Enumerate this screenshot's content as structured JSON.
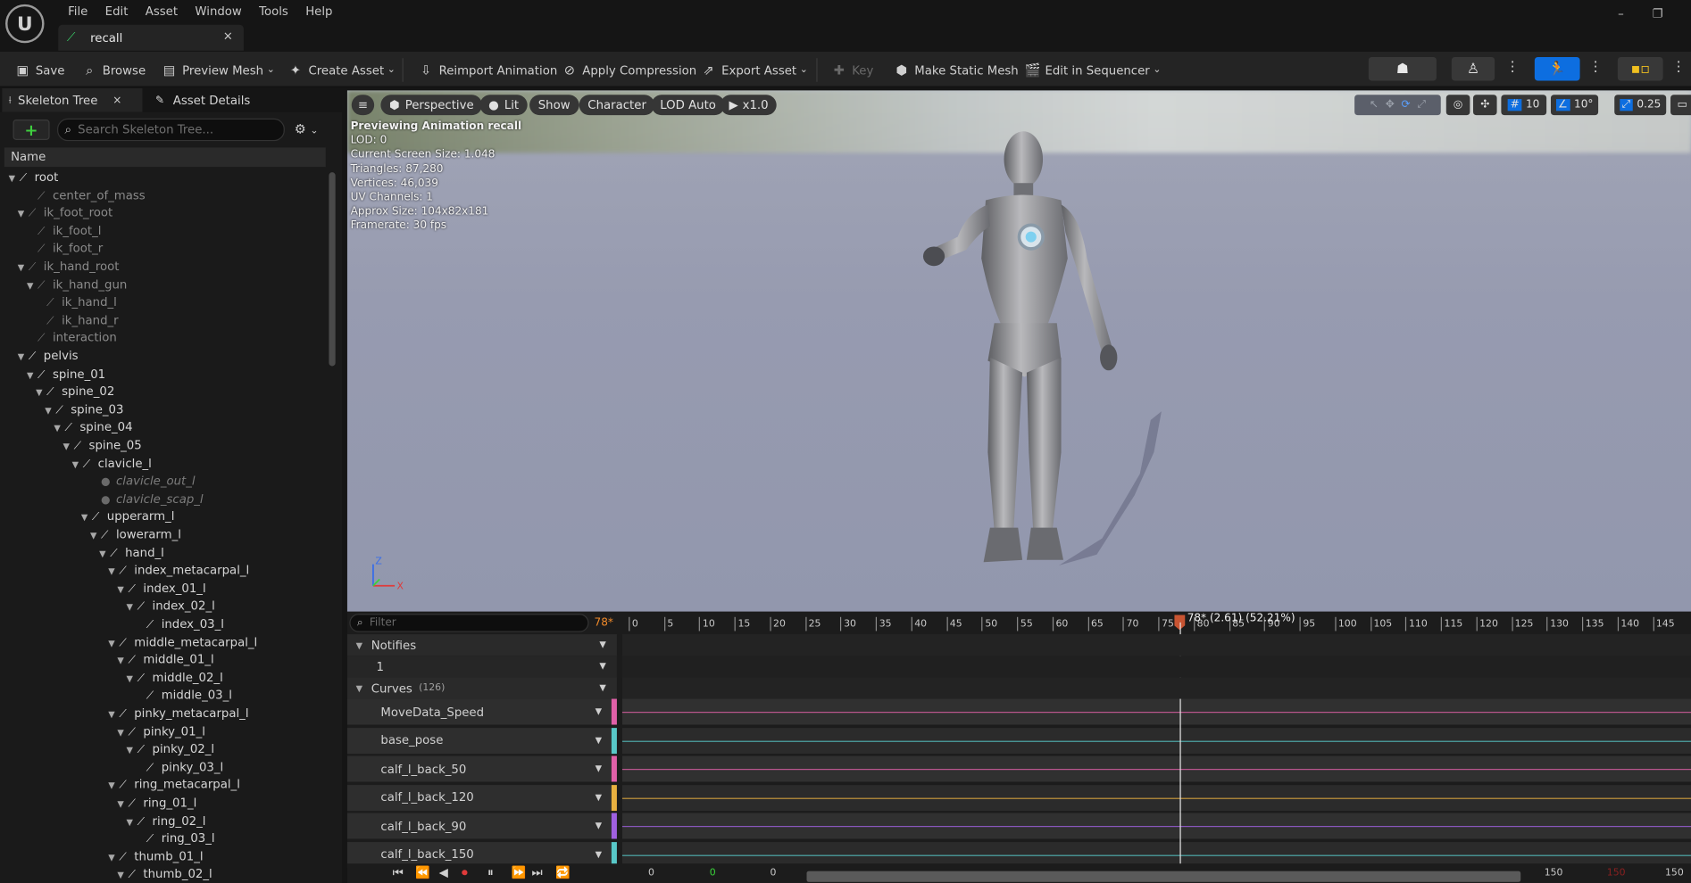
{
  "app": {
    "logo_text": "U"
  },
  "menu": [
    "File",
    "Edit",
    "Asset",
    "Window",
    "Tools",
    "Help"
  ],
  "doc_tab": {
    "title": "recall",
    "close": "×"
  },
  "window_controls": {
    "minimize": "–",
    "restore": "❐"
  },
  "toolbar": {
    "save": "Save",
    "browse": "Browse",
    "preview_mesh": "Preview Mesh",
    "create_asset": "Create Asset",
    "reimport_animation": "Reimport Animation",
    "apply_compression": "Apply Compression",
    "export_asset": "Export Asset",
    "key": "Key",
    "make_static_mesh": "Make Static Mesh",
    "edit_in_sequencer": "Edit in Sequencer"
  },
  "left_panel": {
    "tabs": [
      {
        "label": "Skeleton Tree",
        "close": "×"
      },
      {
        "label": "Asset Details"
      }
    ],
    "search_placeholder": "Search Skeleton Tree...",
    "column_header": "Name",
    "bones": [
      {
        "name": "root",
        "depth": 0,
        "expand": true,
        "kind": "bone"
      },
      {
        "name": "center_of_mass",
        "depth": 2,
        "expand": false,
        "kind": "dim"
      },
      {
        "name": "ik_foot_root",
        "depth": 1,
        "expand": true,
        "kind": "dim"
      },
      {
        "name": "ik_foot_l",
        "depth": 2,
        "expand": false,
        "kind": "dim"
      },
      {
        "name": "ik_foot_r",
        "depth": 2,
        "expand": false,
        "kind": "dim"
      },
      {
        "name": "ik_hand_root",
        "depth": 1,
        "expand": true,
        "kind": "dim"
      },
      {
        "name": "ik_hand_gun",
        "depth": 2,
        "expand": true,
        "kind": "dim"
      },
      {
        "name": "ik_hand_l",
        "depth": 3,
        "expand": false,
        "kind": "dim"
      },
      {
        "name": "ik_hand_r",
        "depth": 3,
        "expand": false,
        "kind": "dim"
      },
      {
        "name": "interaction",
        "depth": 2,
        "expand": false,
        "kind": "dim"
      },
      {
        "name": "pelvis",
        "depth": 1,
        "expand": true,
        "kind": "bone"
      },
      {
        "name": "spine_01",
        "depth": 2,
        "expand": true,
        "kind": "bone"
      },
      {
        "name": "spine_02",
        "depth": 3,
        "expand": true,
        "kind": "bone"
      },
      {
        "name": "spine_03",
        "depth": 4,
        "expand": true,
        "kind": "bone"
      },
      {
        "name": "spine_04",
        "depth": 5,
        "expand": true,
        "kind": "bone"
      },
      {
        "name": "spine_05",
        "depth": 6,
        "expand": true,
        "kind": "bone"
      },
      {
        "name": "clavicle_l",
        "depth": 7,
        "expand": true,
        "kind": "bone"
      },
      {
        "name": "clavicle_out_l",
        "depth": 9,
        "expand": false,
        "kind": "socket"
      },
      {
        "name": "clavicle_scap_l",
        "depth": 9,
        "expand": false,
        "kind": "socket"
      },
      {
        "name": "upperarm_l",
        "depth": 8,
        "expand": true,
        "kind": "bone"
      },
      {
        "name": "lowerarm_l",
        "depth": 9,
        "expand": true,
        "kind": "bone"
      },
      {
        "name": "hand_l",
        "depth": 10,
        "expand": true,
        "kind": "bone"
      },
      {
        "name": "index_metacarpal_l",
        "depth": 11,
        "expand": true,
        "kind": "bone"
      },
      {
        "name": "index_01_l",
        "depth": 12,
        "expand": true,
        "kind": "bone"
      },
      {
        "name": "index_02_l",
        "depth": 13,
        "expand": true,
        "kind": "bone"
      },
      {
        "name": "index_03_l",
        "depth": 14,
        "expand": false,
        "kind": "bone"
      },
      {
        "name": "middle_metacarpal_l",
        "depth": 11,
        "expand": true,
        "kind": "bone"
      },
      {
        "name": "middle_01_l",
        "depth": 12,
        "expand": true,
        "kind": "bone"
      },
      {
        "name": "middle_02_l",
        "depth": 13,
        "expand": true,
        "kind": "bone"
      },
      {
        "name": "middle_03_l",
        "depth": 14,
        "expand": false,
        "kind": "bone"
      },
      {
        "name": "pinky_metacarpal_l",
        "depth": 11,
        "expand": true,
        "kind": "bone"
      },
      {
        "name": "pinky_01_l",
        "depth": 12,
        "expand": true,
        "kind": "bone"
      },
      {
        "name": "pinky_02_l",
        "depth": 13,
        "expand": true,
        "kind": "bone"
      },
      {
        "name": "pinky_03_l",
        "depth": 14,
        "expand": false,
        "kind": "bone"
      },
      {
        "name": "ring_metacarpal_l",
        "depth": 11,
        "expand": true,
        "kind": "bone"
      },
      {
        "name": "ring_01_l",
        "depth": 12,
        "expand": true,
        "kind": "bone"
      },
      {
        "name": "ring_02_l",
        "depth": 13,
        "expand": true,
        "kind": "bone"
      },
      {
        "name": "ring_03_l",
        "depth": 14,
        "expand": false,
        "kind": "bone"
      },
      {
        "name": "thumb_01_l",
        "depth": 11,
        "expand": true,
        "kind": "bone"
      },
      {
        "name": "thumb_02_l",
        "depth": 12,
        "expand": true,
        "kind": "bone"
      }
    ]
  },
  "viewport": {
    "pills": {
      "perspective": "Perspective",
      "lit": "Lit",
      "show": "Show",
      "character": "Character",
      "lod": "LOD Auto",
      "speed": "x1.0"
    },
    "info": [
      "Previewing Animation recall",
      "LOD: 0",
      "Current Screen Size: 1.048",
      "Triangles: 87,280",
      "Vertices: 46,039",
      "UV Channels: 1",
      "Approx Size: 104x82x181",
      "Framerate: 30 fps"
    ],
    "grid_snap": "10",
    "rotation_snap": "10°",
    "scale_snap": "0.25",
    "axis_z": "Z",
    "axis_x": "X"
  },
  "sequencer": {
    "filter_placeholder": "Filter",
    "current_frame_label": "78*",
    "playhead_label": "78* (2.61) (52.21%)",
    "playhead_frame": 78,
    "visible_frame_range": [
      0,
      145
    ],
    "notifies": {
      "label": "Notifies",
      "track": "1"
    },
    "curves": {
      "label": "Curves",
      "count": "(126)"
    },
    "curve_tracks": [
      {
        "name": "MoveData_Speed",
        "color": "#e060a8"
      },
      {
        "name": "base_pose",
        "color": "#58c8c8"
      },
      {
        "name": "calf_l_back_50",
        "color": "#e060a8"
      },
      {
        "name": "calf_l_back_120",
        "color": "#e8b040"
      },
      {
        "name": "calf_l_back_90",
        "color": "#a060e0"
      },
      {
        "name": "calf_l_back_150",
        "color": "#58c8c8"
      }
    ],
    "ruler_ticks": [
      "0",
      "5",
      "10",
      "15",
      "20",
      "25",
      "30",
      "35",
      "40",
      "45",
      "50",
      "55",
      "60",
      "65",
      "70",
      "75",
      "80",
      "85",
      "90",
      "95",
      "100",
      "105",
      "110",
      "115",
      "120",
      "125",
      "130",
      "135",
      "140",
      "145"
    ],
    "transport": {
      "start": "0",
      "green": "0",
      "current": "0",
      "end_a": "150",
      "end_red": "150",
      "end_b": "150"
    }
  },
  "colors": {
    "accent": "#0d6ee0",
    "playhead": "#c85432",
    "frame_label": "#f08a2a",
    "add_green": "#3fcf3f"
  }
}
